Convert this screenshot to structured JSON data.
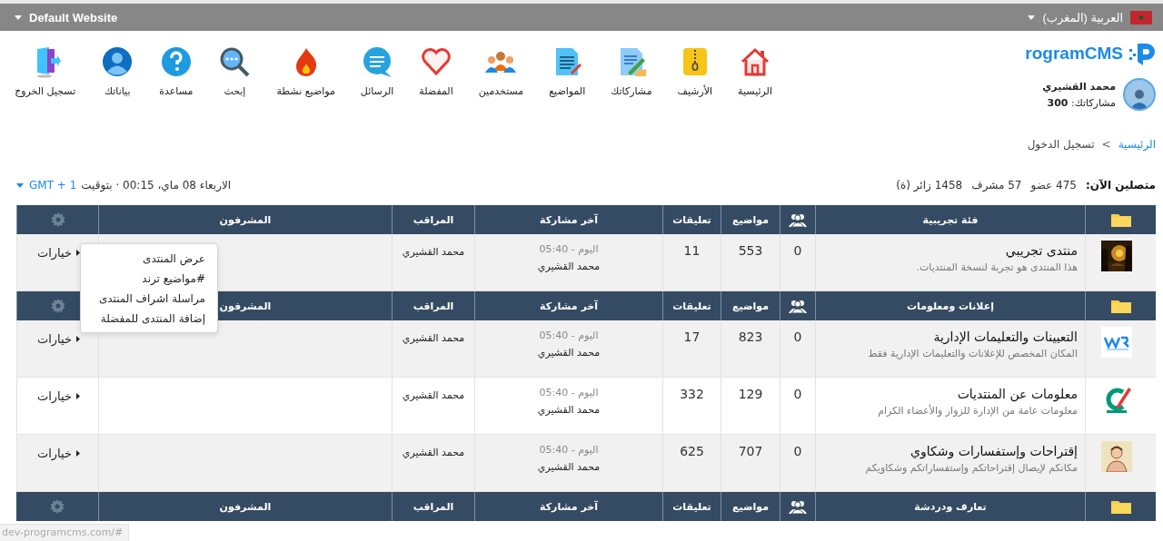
{
  "top_bar": {
    "site_selector": "Default Website",
    "language": "العربية (المغرب)"
  },
  "header": {
    "brand": "rogramCMS",
    "user": {
      "name": "محمد القشيري",
      "posts": "مشاركاتك: **300**"
    },
    "nav": [
      {
        "label": "الرئيسية"
      },
      {
        "label": "الأرشيف"
      },
      {
        "label": "مشاركاتك"
      },
      {
        "label": "المواضيع"
      },
      {
        "label": "مستخدمين"
      },
      {
        "label": "المفضلة"
      },
      {
        "label": "الرسائل"
      },
      {
        "label": "مواضيع نشطة"
      },
      {
        "label": "إبحث"
      },
      {
        "label": "مساعدة"
      },
      {
        "label": "بياناتك"
      },
      {
        "label": "تسجيل الخروج"
      }
    ]
  },
  "breadcrumb": {
    "items": [
      {
        "label": "الرئيسية",
        "link": true
      },
      {
        "label": "تسجيل الدخول",
        "link": false
      }
    ],
    "separator": ">"
  },
  "online": {
    "label": "متصلين الآن:",
    "members": "475 عضو",
    "moderators": "57 مشرف",
    "visitors": "1458 زائر (ة)"
  },
  "clock": {
    "text": "الاربعاء 08 ماي، 00:15 · بتوقيت",
    "timezone": "GMT + 1"
  },
  "sections": [
    {
      "title": "فئة تجريبية",
      "columns": [
        "مواضيع",
        "تعليقات",
        "آخر مشاركة",
        "المراقب",
        "المشرفون"
      ],
      "rows": [
        {
          "title": "منتدى تجريبي",
          "description": "هذا المنتدى هو تجربة لنسخة المنتديات.",
          "users": "0",
          "topics": "553",
          "comments": "11",
          "last_time": "اليوم - 05:40",
          "last_user": "محمد القشيري",
          "moderator": "محمد القشيري",
          "options": "خيارات"
        }
      ]
    },
    {
      "title": "إعلانات ومعلومات",
      "columns": [
        "مواضيع",
        "تعليقات",
        "آخر مشاركة",
        "المراقب",
        "المشرفون"
      ],
      "rows": [
        {
          "title": "التعيينات والتعليمات الإدارية",
          "description": "المكان المخصص للإعلانات والتعليمات الإدارية فقط",
          "users": "0",
          "topics": "823",
          "comments": "17",
          "last_time": "اليوم - 05:40",
          "last_user": "محمد القشيري",
          "moderator": "محمد القشيري",
          "options": "خيارات"
        },
        {
          "title": "معلومات عن المنتديات",
          "description": "معلومات عامة من الإدارة للزوار والأعضاء الكرام",
          "users": "0",
          "topics": "129",
          "comments": "332",
          "last_time": "اليوم - 05:40",
          "last_user": "محمد القشيري",
          "moderator": "محمد القشيري",
          "options": "خيارات"
        },
        {
          "title": "إقتراحات وإستفسارات وشكاوي",
          "description": "مكانكم لإيصال إقتراحاتكم وإستفساراتكم وشكاويكم",
          "users": "0",
          "topics": "707",
          "comments": "625",
          "last_time": "اليوم - 05:40",
          "last_user": "محمد القشيري",
          "moderator": "محمد القشيري",
          "options": "خيارات"
        }
      ]
    },
    {
      "title": "تعارف ودردشة",
      "columns": [
        "مواضيع",
        "تعليقات",
        "آخر مشاركة",
        "المراقب",
        "المشرفون"
      ]
    }
  ],
  "options_menu": {
    "items": [
      "عرض المنتدى",
      "#مواضيع ترند",
      "مراسلة اشراف المنتدى",
      "إضافة المنتدى للمفضلة"
    ]
  },
  "status_url": "dev-programcms.com/#"
}
